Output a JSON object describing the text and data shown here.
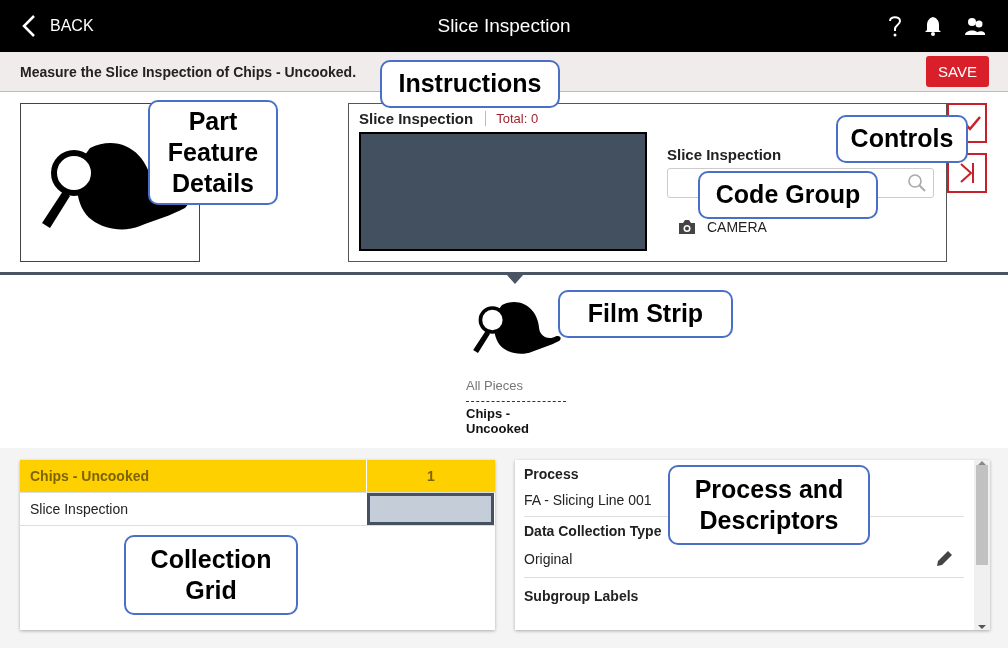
{
  "header": {
    "back_label": "BACK",
    "title": "Slice Inspection"
  },
  "instruction": {
    "text": "Measure the Slice Inspection of Chips - Uncooked.",
    "save_label": "SAVE"
  },
  "code_group": {
    "title": "Slice Inspection",
    "total": "Total: 0",
    "field_label": "Slice Inspection",
    "camera_label": "CAMERA"
  },
  "film_strip": {
    "items": [
      {
        "label": "All Pieces",
        "selected": false
      },
      {
        "label": "Chips - Uncooked",
        "selected": true
      }
    ]
  },
  "collection_grid": {
    "header": {
      "name": "Chips - Uncooked",
      "count": "1"
    },
    "rows": [
      {
        "name": "Slice Inspection",
        "selected": true
      }
    ]
  },
  "descriptors": [
    {
      "label": "Process",
      "value": "FA - Slicing Line 001",
      "editable": false
    },
    {
      "label": "Data Collection Type",
      "value": "Original",
      "editable": true
    },
    {
      "label": "Subgroup Labels"
    }
  ],
  "callouts": [
    "Instructions",
    "Part Feature Details",
    "Controls",
    "Code Group",
    "Film Strip",
    "Collection Grid",
    "Process and Descriptors"
  ]
}
